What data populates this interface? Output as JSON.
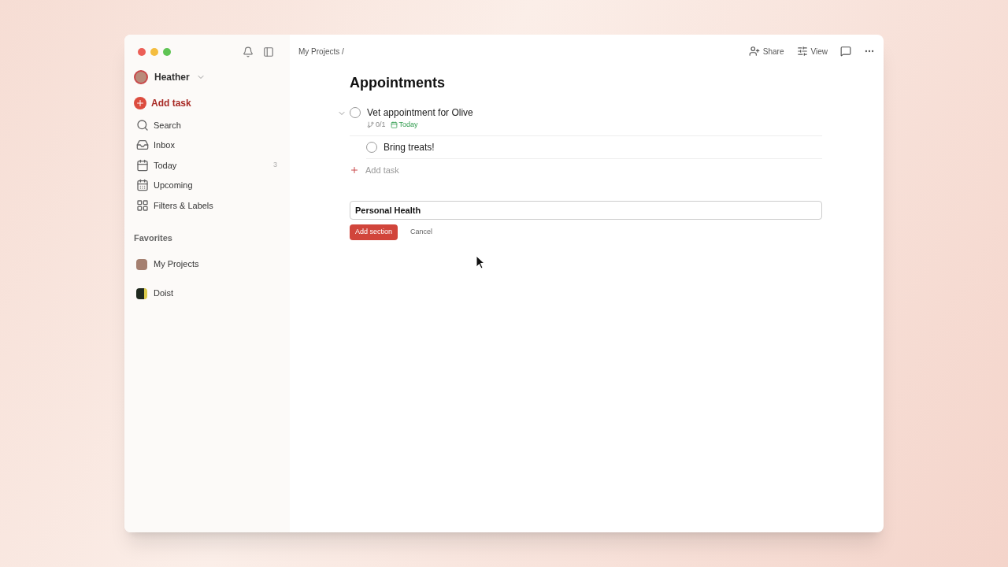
{
  "sidebar": {
    "user": "Heather",
    "add_task": "Add task",
    "nav": [
      {
        "kind": "search",
        "label": "Search"
      },
      {
        "kind": "inbox",
        "label": "Inbox"
      },
      {
        "kind": "today",
        "label": "Today",
        "count": "3"
      },
      {
        "kind": "upcoming",
        "label": "Upcoming"
      },
      {
        "kind": "filters",
        "label": "Filters & Labels"
      }
    ],
    "favorites_heading": "Favorites",
    "projects": [
      {
        "kind": "photo",
        "label": "My Projects"
      },
      {
        "kind": "logo",
        "label": "Doist"
      }
    ]
  },
  "header": {
    "breadcrumb": "My Projects /",
    "share": "Share",
    "view": "View"
  },
  "project": {
    "title": "Appointments",
    "tasks": [
      {
        "title": "Vet appointment for Olive",
        "completed": false,
        "expanded": true,
        "subtasks_count": "0/1",
        "due": "Today",
        "children": [
          {
            "title": "Bring treats!",
            "completed": false
          }
        ]
      }
    ],
    "add_task": "Add task"
  },
  "section_form": {
    "value": "Personal Health",
    "submit": "Add section",
    "cancel": "Cancel"
  }
}
